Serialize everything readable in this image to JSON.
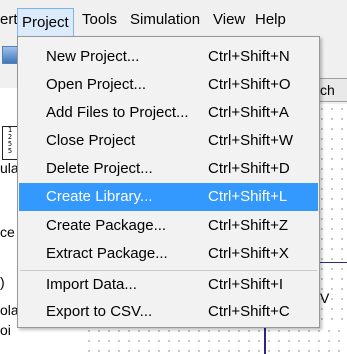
{
  "menubar": {
    "items": [
      {
        "label": "ert"
      },
      {
        "label": "Project"
      },
      {
        "label": "Tools"
      },
      {
        "label": "Simulation"
      },
      {
        "label": "View"
      },
      {
        "label": "Help"
      }
    ]
  },
  "background": {
    "left_panel": {
      "frag1": "ula",
      "frag2": "ce",
      "frag3": ")",
      "frag4": "ola",
      "frag5": "oi",
      "mini_grid": [
        "1",
        "2",
        "5",
        "5"
      ]
    },
    "right_button": "ch",
    "right_letter": "V"
  },
  "project_menu": {
    "items": [
      {
        "label": "New Project...",
        "shortcut": "Ctrl+Shift+N"
      },
      {
        "label": "Open Project...",
        "shortcut": "Ctrl+Shift+O"
      },
      {
        "label": "Add Files to Project...",
        "shortcut": "Ctrl+Shift+A"
      },
      {
        "label": "Close Project",
        "shortcut": "Ctrl+Shift+W"
      },
      {
        "label": "Delete Project...",
        "shortcut": "Ctrl+Shift+D"
      },
      {
        "label": "Create Library...",
        "shortcut": "Ctrl+Shift+L",
        "highlighted": true
      },
      {
        "label": "Create Package...",
        "shortcut": "Ctrl+Shift+Z"
      },
      {
        "label": "Extract Package...",
        "shortcut": "Ctrl+Shift+X"
      },
      {
        "label": "Import Data...",
        "shortcut": "Ctrl+Shift+I"
      },
      {
        "label": "Export to CSV...",
        "shortcut": "Ctrl+Shift+C"
      }
    ]
  },
  "colors": {
    "highlight": "#3399ff",
    "menu_active_bg": "#dcebfb"
  }
}
